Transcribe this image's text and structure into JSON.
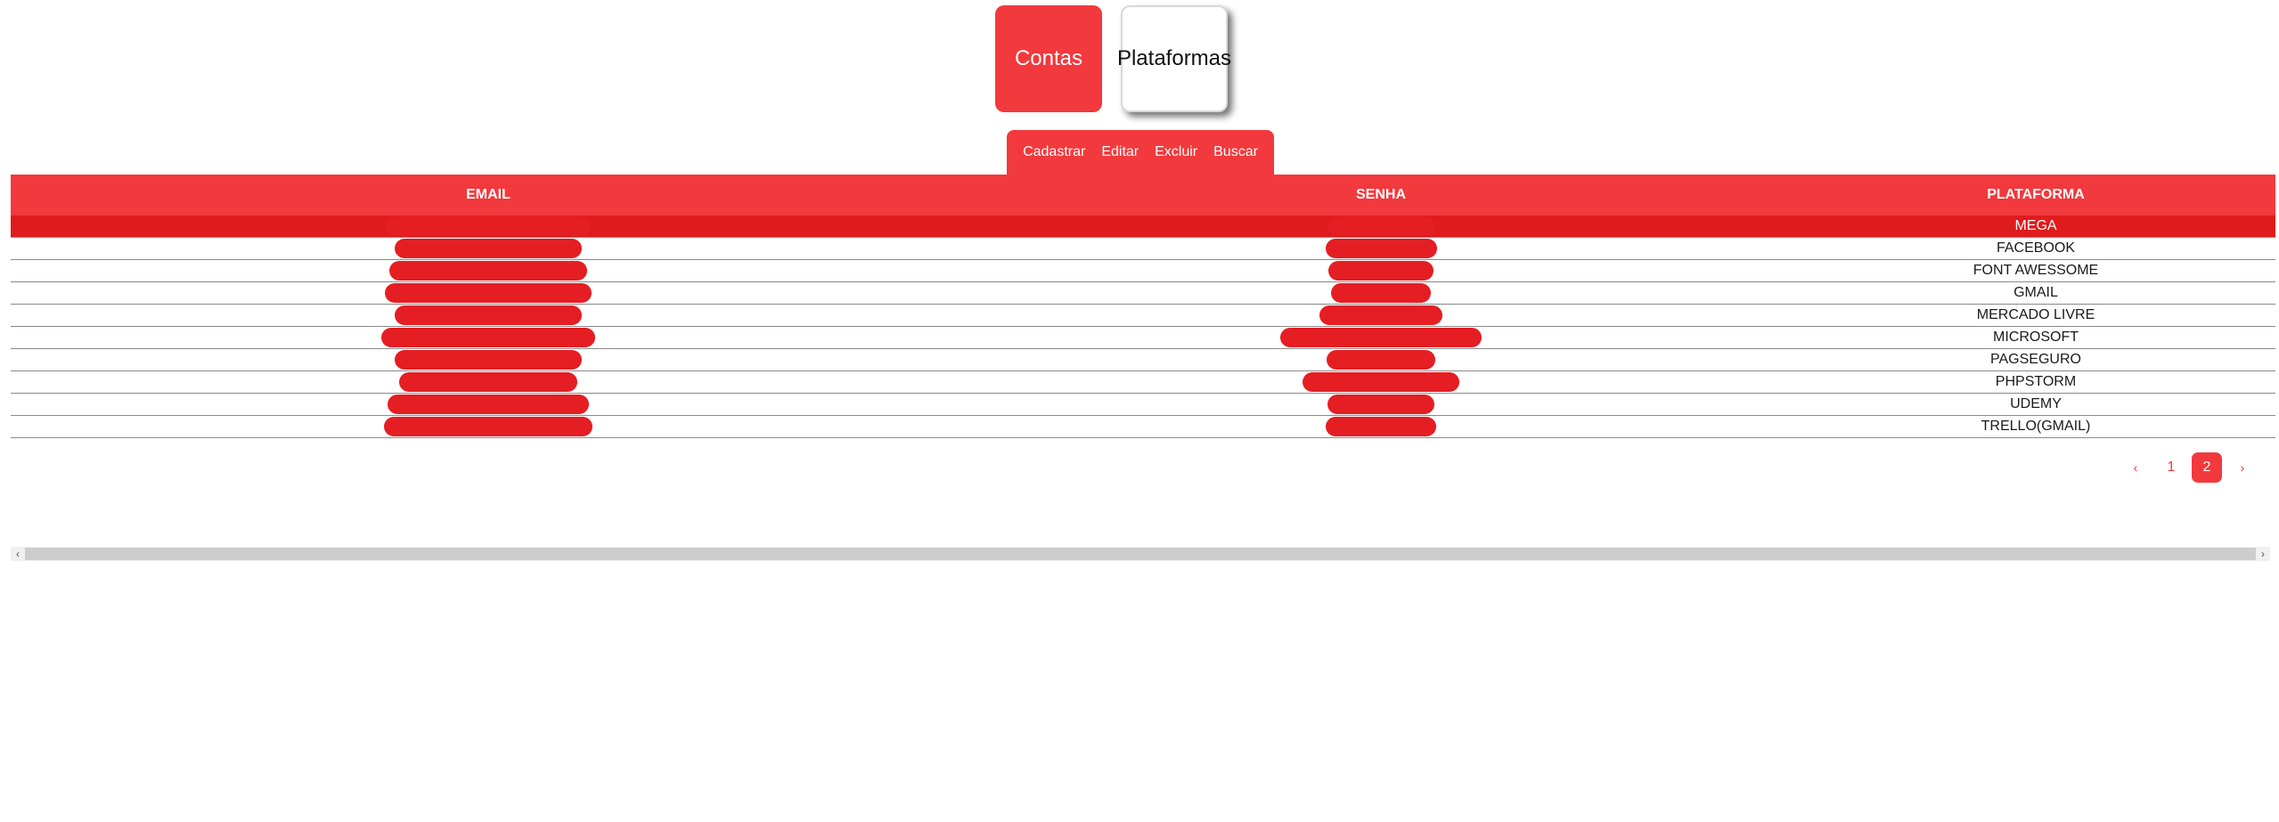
{
  "nav": {
    "contas_label": "Contas",
    "plataformas_label": "Plataformas"
  },
  "actions": {
    "cadastrar": "Cadastrar",
    "editar": "Editar",
    "excluir": "Excluir",
    "buscar": "Buscar"
  },
  "table": {
    "headers": {
      "email": "EMAIL",
      "senha": "SENHA",
      "plataforma": "PLATAFORMA"
    },
    "rows": [
      {
        "plataforma": "MEGA"
      },
      {
        "plataforma": "FACEBOOK"
      },
      {
        "plataforma": "FONT AWESSOME"
      },
      {
        "plataforma": "GMAIL"
      },
      {
        "plataforma": "MERCADO LIVRE"
      },
      {
        "plataforma": "MICROSOFT"
      },
      {
        "plataforma": "PAGSEGURO"
      },
      {
        "plataforma": "PHPSTORM"
      },
      {
        "plataforma": "UDEMY"
      },
      {
        "plataforma": "TRELLO(GMAIL)"
      }
    ]
  },
  "pagination": {
    "prev": "‹",
    "page1": "1",
    "page2": "2",
    "next": "›",
    "current": 2
  },
  "colors": {
    "accent": "#f2393d",
    "selected_row": "#e01b1e"
  }
}
